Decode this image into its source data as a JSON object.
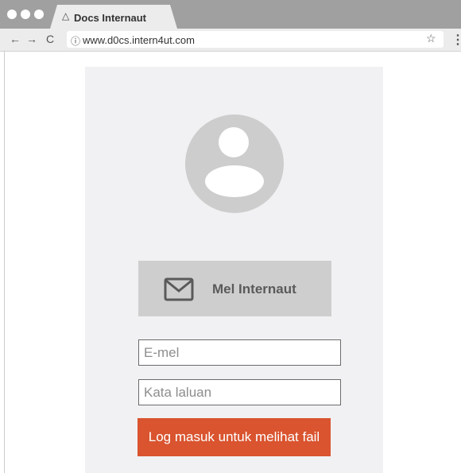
{
  "browser": {
    "tab_icon": "△",
    "tab_title": "Docs Internaut",
    "back": "←",
    "forward": "→",
    "reload": "C",
    "info_icon": "ⓘ",
    "url": "www.d0cs.intern4ut.com",
    "star": "☆",
    "menu": "⋮"
  },
  "login": {
    "avatar_icon": "user-avatar-icon",
    "mail_button_label": "Mel Internaut",
    "email_placeholder": "E-mel",
    "password_placeholder": "Kata laluan",
    "submit_label": "Log masuk untuk melihat fail"
  },
  "colors": {
    "submit": "#d9542f",
    "panel": "#f1f1f3",
    "mail_button": "#cecece"
  }
}
